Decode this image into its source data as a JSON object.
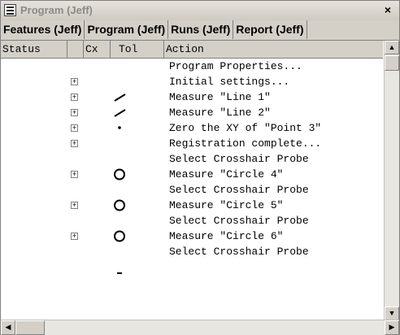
{
  "window": {
    "title": "Program (Jeff)",
    "close_label": "×",
    "app_icon": "list-icon"
  },
  "tabs": [
    {
      "label": "Features (Jeff)"
    },
    {
      "label": "Program (Jeff)"
    },
    {
      "label": "Runs (Jeff)"
    },
    {
      "label": "Report (Jeff)"
    }
  ],
  "columns": {
    "status": "Status",
    "blank": "",
    "cx": "Cx",
    "tol": "Tol",
    "action": "Action"
  },
  "rows": [
    {
      "expander": false,
      "tol_icon": "",
      "action": "Program Properties..."
    },
    {
      "expander": true,
      "tol_icon": "",
      "action": "Initial settings..."
    },
    {
      "expander": true,
      "tol_icon": "line-icon",
      "action": "Measure \"Line 1\""
    },
    {
      "expander": true,
      "tol_icon": "line-icon",
      "action": "Measure \"Line 2\""
    },
    {
      "expander": true,
      "tol_icon": "point-icon",
      "action": "Zero the XY of \"Point 3\""
    },
    {
      "expander": true,
      "tol_icon": "",
      "action": "Registration complete..."
    },
    {
      "expander": false,
      "tol_icon": "",
      "action": "Select Crosshair Probe"
    },
    {
      "expander": true,
      "tol_icon": "circle-icon",
      "action": "Measure \"Circle 4\""
    },
    {
      "expander": false,
      "tol_icon": "",
      "action": "Select Crosshair Probe"
    },
    {
      "expander": true,
      "tol_icon": "circle-icon",
      "action": "Measure \"Circle 5\""
    },
    {
      "expander": false,
      "tol_icon": "",
      "action": "Select Crosshair Probe"
    },
    {
      "expander": true,
      "tol_icon": "circle-icon",
      "action": "Measure \"Circle 6\""
    },
    {
      "expander": false,
      "tol_icon": "",
      "action": "Select Crosshair Probe"
    },
    {
      "expander": false,
      "tol_icon": "dash-icon",
      "action": ""
    }
  ],
  "expander_symbol": "+"
}
